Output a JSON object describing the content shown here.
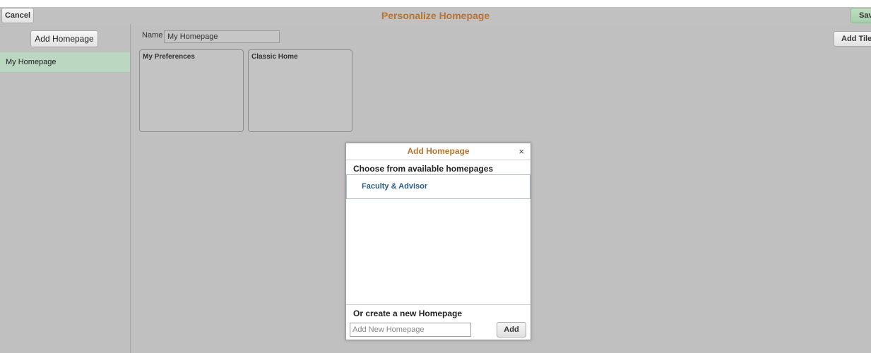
{
  "header": {
    "cancel_label": "Cancel",
    "title": "Personalize Homepage",
    "save_label": "Sav"
  },
  "sidebar": {
    "add_homepage_label": "Add Homepage",
    "items": [
      {
        "label": "My Homepage",
        "selected": true
      }
    ]
  },
  "main": {
    "name_label": "Name",
    "name_value": "My Homepage",
    "add_tile_label": "Add Tile",
    "tiles": [
      {
        "title": "My Preferences"
      },
      {
        "title": "Classic Home"
      }
    ]
  },
  "dialog": {
    "title": "Add Homepage",
    "close_glyph": "×",
    "choose_label": "Choose from available homepages",
    "options": [
      {
        "label": "Faculty & Advisor"
      }
    ],
    "create_label": "Or create a new Homepage",
    "new_placeholder": "Add New Homepage",
    "add_label": "Add"
  },
  "colors": {
    "accent_title": "#b87333",
    "selected_item": "#bbd6c1",
    "save_button": "#a4cfa9",
    "option_text": "#2c5c86",
    "background": "#c0c0c0"
  }
}
